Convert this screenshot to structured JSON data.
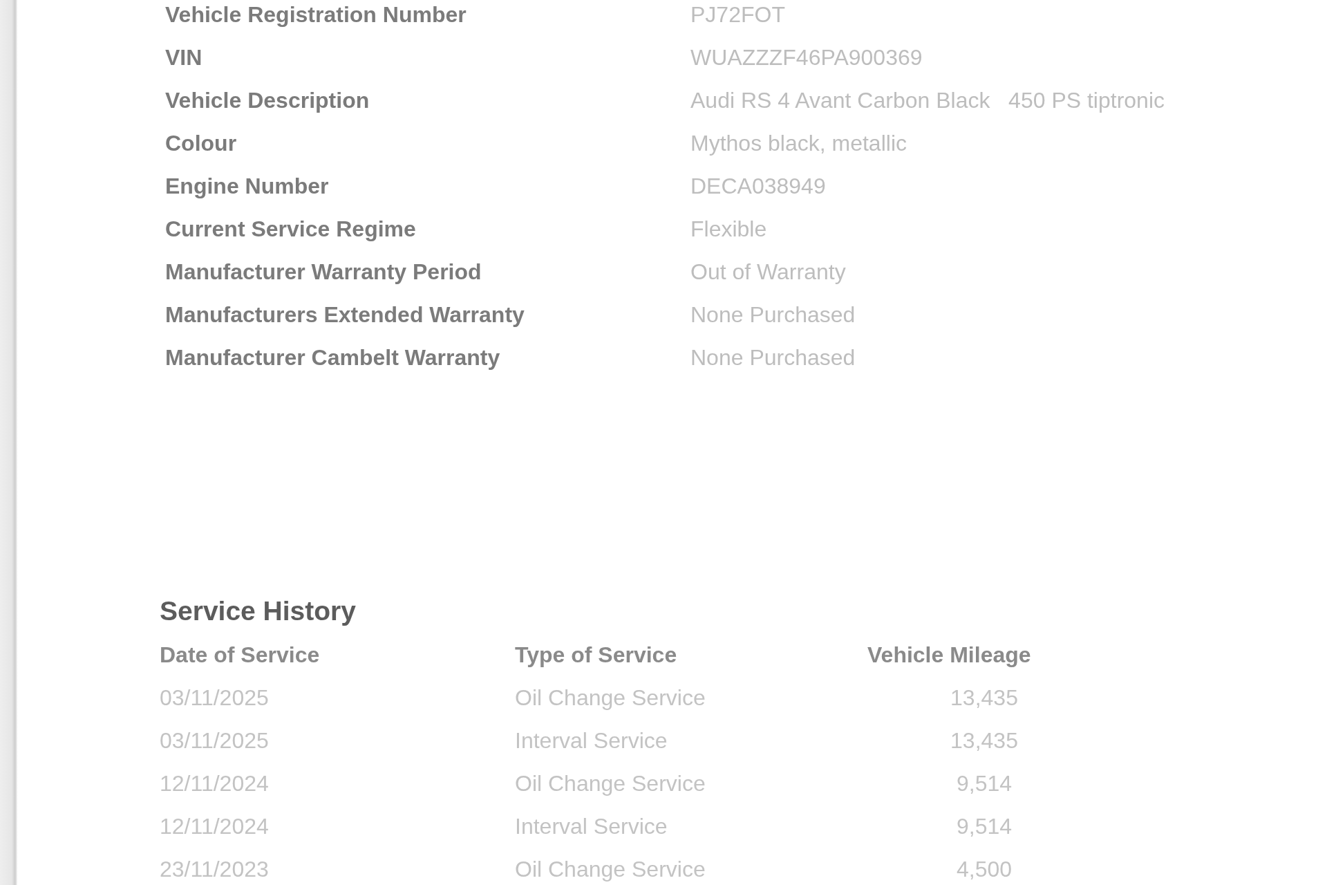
{
  "vehicle_details": [
    {
      "label": "Vehicle Registration Number",
      "value": "PJ72FOT"
    },
    {
      "label": "VIN",
      "value": "WUAZZZF46PA900369"
    },
    {
      "label": "Vehicle Description",
      "value": "Audi RS 4 Avant Carbon Black   450 PS tiptronic"
    },
    {
      "label": "Colour",
      "value": "Mythos black, metallic"
    },
    {
      "label": "Engine Number",
      "value": "DECA038949"
    },
    {
      "label": "Current Service Regime",
      "value": "Flexible"
    },
    {
      "label": "Manufacturer Warranty Period",
      "value": "Out of Warranty"
    },
    {
      "label": "Manufacturers Extended Warranty",
      "value": "None Purchased"
    },
    {
      "label": "Manufacturer Cambelt Warranty",
      "value": "None Purchased"
    }
  ],
  "service_history": {
    "title": "Service History",
    "columns": [
      "Date of Service",
      "Type of Service",
      "Vehicle Mileage"
    ],
    "rows": [
      [
        "03/11/2025",
        "Oil Change Service",
        "13,435"
      ],
      [
        "03/11/2025",
        "Interval Service",
        "13,435"
      ],
      [
        "12/11/2024",
        "Oil Change Service",
        "9,514"
      ],
      [
        "12/11/2024",
        "Interval Service",
        "9,514"
      ],
      [
        "23/11/2023",
        "Oil Change Service",
        "4,500"
      ]
    ]
  }
}
